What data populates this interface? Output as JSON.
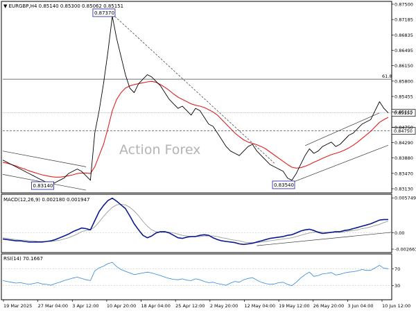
{
  "header": {
    "symbol": "EURGBP,H4",
    "ohlc": "0.85140 0.85300 0.85062 0.85151"
  },
  "watermark": "Action Forex",
  "colors": {
    "price": "#000000",
    "ma": "#e02020",
    "macd": "#0a1a8c",
    "signal": "#9a9a9a",
    "rsi": "#2e86de",
    "grid": "#c8c8c8",
    "callout_border": "#1a1aaa"
  },
  "chart_data": [
    {
      "type": "line",
      "panel": "price",
      "title": "EURGBP,H4",
      "x_ticks": [
        "19 Mar 2025",
        "27 Mar 04:00",
        "3 Apr 12:00",
        "10 Apr 20:00",
        "18 Apr 04:00",
        "25 Apr 12:00",
        "2 May 20:00",
        "12 May 04:00",
        "19 May 12:00",
        "26 May 20:00",
        "3 Jun 04:00",
        "10 Jun 12:00"
      ],
      "ylim": [
        0.834,
        0.876
      ],
      "y_ticks": [
        "0.87500",
        "0.87185",
        "0.86835",
        "0.86495",
        "0.86150",
        "0.85800",
        "0.85455",
        "0.85115",
        "0.84750",
        "0.84290",
        "0.83880",
        "0.83470",
        "0.83130"
      ],
      "series": [
        {
          "role": "price",
          "values": [
            0.841,
            0.8405,
            0.84,
            0.8395,
            0.839,
            0.8385,
            0.838,
            0.8375,
            0.837,
            0.8365,
            0.836,
            0.8355,
            0.836,
            0.8365,
            0.837,
            0.838,
            0.8385,
            0.839,
            0.8385,
            0.8375,
            0.8365,
            0.847,
            0.852,
            0.858,
            0.865,
            0.873,
            0.868,
            0.864,
            0.86,
            0.857,
            0.856,
            0.858,
            0.859,
            0.86,
            0.8595,
            0.8585,
            0.8575,
            0.856,
            0.8545,
            0.8535,
            0.8525,
            0.853,
            0.852,
            0.851,
            0.8525,
            0.852,
            0.8505,
            0.849,
            0.8485,
            0.847,
            0.8455,
            0.844,
            0.843,
            0.8425,
            0.842,
            0.843,
            0.844,
            0.8445,
            0.843,
            0.842,
            0.841,
            0.84,
            0.8395,
            0.839,
            0.8385,
            0.837,
            0.8365,
            0.838,
            0.84,
            0.842,
            0.8435,
            0.8425,
            0.843,
            0.844,
            0.8445,
            0.845,
            0.844,
            0.8445,
            0.8455,
            0.8465,
            0.847,
            0.848,
            0.849,
            0.8495,
            0.85,
            0.852,
            0.854,
            0.8525,
            0.8515
          ]
        },
        {
          "role": "ma",
          "values": [
            0.8405,
            0.8403,
            0.84,
            0.8397,
            0.8393,
            0.839,
            0.8386,
            0.8383,
            0.838,
            0.8377,
            0.8375,
            0.8373,
            0.8372,
            0.8372,
            0.8373,
            0.8375,
            0.8377,
            0.838,
            0.8381,
            0.8381,
            0.838,
            0.8395,
            0.842,
            0.8445,
            0.848,
            0.852,
            0.8545,
            0.856,
            0.857,
            0.8575,
            0.8578,
            0.858,
            0.8582,
            0.8584,
            0.8585,
            0.8583,
            0.8578,
            0.8572,
            0.8565,
            0.8557,
            0.855,
            0.8545,
            0.854,
            0.8535,
            0.8532,
            0.853,
            0.8527,
            0.8522,
            0.8517,
            0.851,
            0.85,
            0.849,
            0.848,
            0.847,
            0.8462,
            0.8455,
            0.845,
            0.8447,
            0.8444,
            0.844,
            0.8435,
            0.8428,
            0.8421,
            0.8414,
            0.8407,
            0.84,
            0.8394,
            0.8392,
            0.8393,
            0.8396,
            0.84,
            0.8405,
            0.8409,
            0.8414,
            0.8418,
            0.8422,
            0.8425,
            0.8428,
            0.8432,
            0.8437,
            0.8443,
            0.845,
            0.8458,
            0.8466,
            0.8474,
            0.8484,
            0.8494,
            0.85,
            0.8505
          ]
        }
      ],
      "lines": {
        "fib_level": 0.859,
        "fib_label": "61.8",
        "support": 0.8475,
        "last_price_dotted": 0.8515,
        "trend_start": 0.8735,
        "trend_end": 0.8403
      },
      "price_tags": [
        {
          "label": "0.85151",
          "value": 0.8515
        },
        {
          "label": "0.84750",
          "value": 0.8475
        }
      ],
      "annotations": [
        {
          "label": "0.87370",
          "value": 0.8737,
          "index": 25
        },
        {
          "label": "0.83140",
          "value": 0.8314,
          "index": 11
        },
        {
          "label": "0.83540",
          "value": 0.8354,
          "index": 66
        }
      ]
    },
    {
      "type": "line",
      "panel": "macd",
      "title": "MACD(12,26,9) 0.002180 0.001947",
      "ylim": [
        -0.003,
        0.006
      ],
      "y_ticks": [
        "0.005749",
        "0.00",
        "-0.002663"
      ],
      "series": [
        {
          "role": "macd",
          "values": [
            -0.001,
            -0.0011,
            -0.0012,
            -0.0013,
            -0.0013,
            -0.0014,
            -0.0015,
            -0.0015,
            -0.0015,
            -0.0015,
            -0.0014,
            -0.0013,
            -0.0011,
            -0.0008,
            -0.0005,
            -0.0002,
            0.0002,
            0.0005,
            0.0008,
            0.0007,
            0.0005,
            0.002,
            0.0035,
            0.0045,
            0.0053,
            0.0057,
            0.0052,
            0.0046,
            0.004,
            0.0028,
            0.0015,
            0.0005,
            -0.0004,
            -0.0008,
            -0.0005,
            0.0,
            0.0002,
            0.0002,
            0.0,
            -0.0004,
            -0.0008,
            -0.0009,
            -0.0007,
            -0.0006,
            -0.0006,
            -0.0004,
            -0.0003,
            -0.0004,
            -0.0008,
            -0.0011,
            -0.0013,
            -0.0014,
            -0.0015,
            -0.0016,
            -0.0018,
            -0.0019,
            -0.0018,
            -0.0017,
            -0.0015,
            -0.0013,
            -0.0011,
            -0.0009,
            -0.0008,
            -0.0007,
            -0.0006,
            -0.0004,
            -0.0003,
            0.0,
            0.0003,
            0.0005,
            0.0006,
            0.0004,
            0.0001,
            -0.0001,
            0.0,
            0.0001,
            0.0002,
            0.0002,
            0.0004,
            0.0005,
            0.0007,
            0.0009,
            0.0011,
            0.0013,
            0.0015,
            0.0018,
            0.0021,
            0.0022,
            0.0022
          ]
        },
        {
          "role": "signal",
          "values": [
            -0.0008,
            -0.0009,
            -0.001,
            -0.0011,
            -0.0012,
            -0.0012,
            -0.0013,
            -0.0013,
            -0.0014,
            -0.0014,
            -0.0014,
            -0.0014,
            -0.0013,
            -0.0012,
            -0.001,
            -0.0008,
            -0.0005,
            -0.0002,
            0.0002,
            0.0004,
            0.0005,
            0.001,
            0.0018,
            0.0027,
            0.0035,
            0.0042,
            0.0046,
            0.0047,
            0.0046,
            0.0042,
            0.0036,
            0.0028,
            0.0019,
            0.0011,
            0.0005,
            0.0002,
            0.0001,
            0.0001,
            0.0001,
            0.0,
            -0.0002,
            -0.0004,
            -0.0005,
            -0.0006,
            -0.0006,
            -0.0006,
            -0.0005,
            -0.0005,
            -0.0005,
            -0.0006,
            -0.0008,
            -0.0009,
            -0.0011,
            -0.0012,
            -0.0013,
            -0.0015,
            -0.0016,
            -0.0016,
            -0.0016,
            -0.0015,
            -0.0014,
            -0.0013,
            -0.0012,
            -0.0011,
            -0.001,
            -0.0009,
            -0.0008,
            -0.0006,
            -0.0004,
            -0.0002,
            0.0,
            0.0001,
            0.0002,
            0.0001,
            0.0001,
            0.0001,
            0.0001,
            0.0001,
            0.0002,
            0.0003,
            0.0004,
            0.0005,
            0.0007,
            0.0008,
            0.001,
            0.0012,
            0.0014,
            0.0017,
            0.0019
          ]
        }
      ],
      "trendline": {
        "start_index": 58,
        "start_value": -0.0021,
        "end_index": 88,
        "end_value": 0.0001
      }
    },
    {
      "type": "line",
      "panel": "rsi",
      "title": "RSI(14) 70.1667",
      "ylim": [
        0,
        100
      ],
      "y_ticks": [
        "100",
        "70",
        "30",
        "0"
      ],
      "levels": [
        70,
        30
      ],
      "series": [
        {
          "role": "rsi",
          "values": [
            42,
            40,
            38,
            36,
            37,
            35,
            33,
            35,
            37,
            34,
            33,
            31,
            35,
            38,
            42,
            45,
            48,
            50,
            47,
            44,
            42,
            65,
            72,
            76,
            82,
            85,
            75,
            68,
            64,
            60,
            56,
            58,
            60,
            62,
            60,
            57,
            54,
            50,
            47,
            45,
            44,
            46,
            43,
            42,
            46,
            44,
            40,
            37,
            38,
            35,
            33,
            31,
            36,
            40,
            38,
            44,
            47,
            49,
            43,
            38,
            35,
            33,
            34,
            37,
            38,
            33,
            30,
            38,
            48,
            56,
            62,
            52,
            54,
            58,
            59,
            61,
            55,
            57,
            60,
            62,
            63,
            65,
            68,
            66,
            66,
            72,
            78,
            71,
            70
          ]
        }
      ]
    }
  ]
}
